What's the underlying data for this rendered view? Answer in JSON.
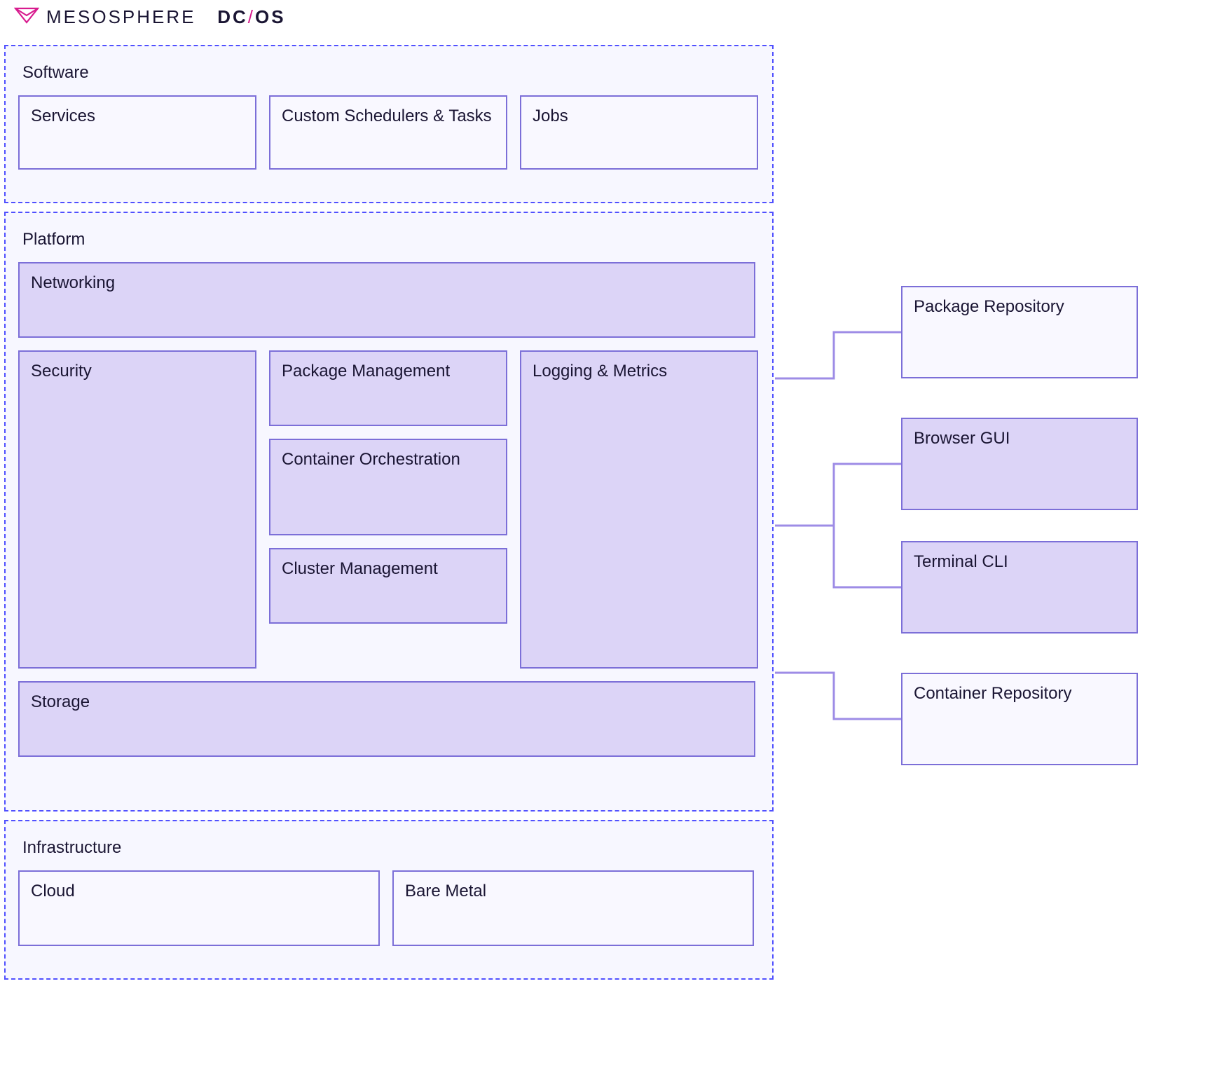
{
  "logo": {
    "brand": "MESOSPHERE",
    "product_bold": "DC",
    "product_slash": "/",
    "product_tail": "OS"
  },
  "groups": {
    "software": {
      "title": "Software",
      "items": {
        "services": "Services",
        "custom_schedulers": "Custom Schedulers & Tasks",
        "jobs": "Jobs"
      }
    },
    "platform": {
      "title": "Platform",
      "items": {
        "networking": "Networking",
        "security": "Security",
        "package_management": "Package Management",
        "container_orchestration": "Container Orchestration",
        "cluster_management": "Cluster Management",
        "logging_metrics": "Logging & Metrics",
        "storage": "Storage"
      }
    },
    "infrastructure": {
      "title": "Infrastructure",
      "items": {
        "cloud": "Cloud",
        "bare_metal": "Bare Metal"
      }
    }
  },
  "external": {
    "package_repository": "Package Repository",
    "browser_gui": "Browser GUI",
    "terminal_cli": "Terminal CLI",
    "container_repository": "Container Repository"
  }
}
